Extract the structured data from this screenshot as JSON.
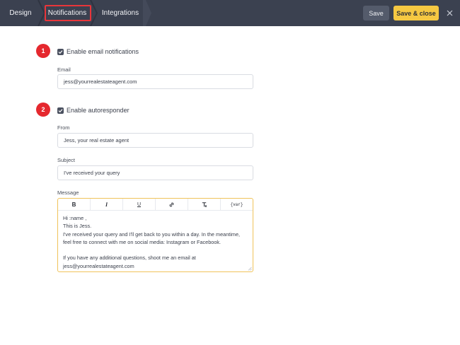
{
  "topbar": {
    "tabs": [
      {
        "label": "Design"
      },
      {
        "label": "Notifications"
      },
      {
        "label": "Integrations"
      }
    ],
    "save_label": "Save",
    "save_close_label": "Save & close",
    "close_icon": "close-icon"
  },
  "colors": {
    "topbar_bg": "#3b4150",
    "accent_yellow": "#f5c842",
    "marker_red": "#e5282e",
    "editor_border": "#f0c35a"
  },
  "section1": {
    "marker": "1",
    "checkbox_label": "Enable email notifications",
    "checked": true,
    "email_label": "Email",
    "email_value": "jess@yourrealestateagent.com"
  },
  "section2": {
    "marker": "2",
    "checkbox_label": "Enable autoresponder",
    "checked": true,
    "from_label": "From",
    "from_value": "Jess, your real estate agent",
    "subject_label": "Subject",
    "subject_value": "I've received your query",
    "message_label": "Message",
    "toolbar": {
      "bold": "B",
      "italic": "I",
      "underline": "U",
      "link_icon": "link-icon",
      "clear_format_icon": "clear-format-icon",
      "var": "{var}"
    },
    "message_lines": [
      "Hi :name ,",
      "This is Jess.",
      "I've received your query and I'll get back to you within a day. In the meantime,",
      "feel free to connect with me on social media: Instagram or Facebook.",
      "",
      "If you have any additional questions, shoot me an email at",
      "jess@yourrealestateagent.com"
    ]
  }
}
